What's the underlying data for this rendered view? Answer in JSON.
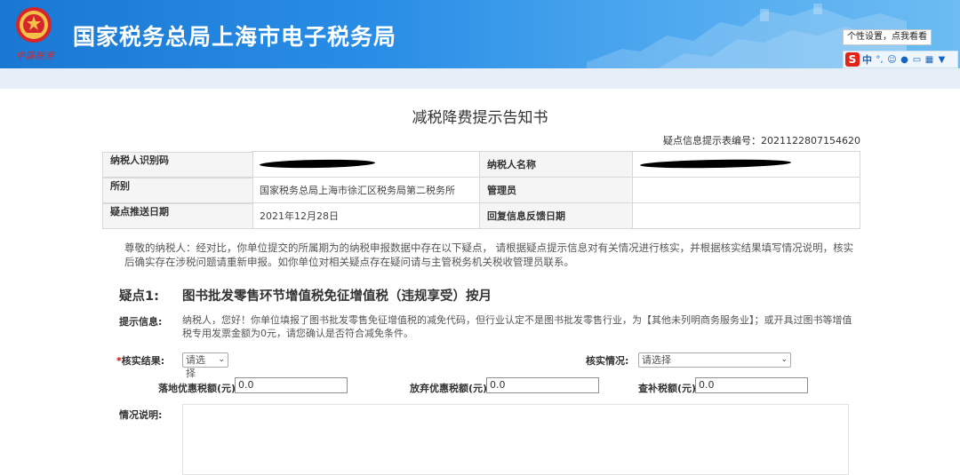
{
  "header": {
    "site_title": "国家税务总局上海市电子税务局",
    "logo_text": "中国税务",
    "tooltip": "个性设置，点我看看",
    "ime_logo": "S",
    "ime_mode": "中",
    "ime_icons": [
      "punctuation-icon",
      "emoji-icon",
      "mic-icon",
      "keyboard-icon",
      "skin-icon",
      "tshirt-icon"
    ]
  },
  "doc": {
    "title": "减税降费提示告知书",
    "serial_label": "疑点信息提示表编号：",
    "serial_no": "2021122807154620"
  },
  "info_table": {
    "taxpayer_id_label": "纳税人识别码",
    "taxpayer_id_value": "",
    "taxpayer_name_label": "纳税人名称",
    "taxpayer_name_value": "",
    "office_label": "所别",
    "office_value": "国家税务总局上海市徐汇区税务局第二税务所",
    "manager_label": "管理员",
    "manager_value": "",
    "push_date_label": "疑点推送日期",
    "push_date_value": "2021年12月28日",
    "feedback_date_label": "回复信息反馈日期",
    "feedback_date_value": ""
  },
  "notice": "尊敬的纳税人：经对比，你单位提交的所属期为的纳税申报数据中存在以下疑点， 请根据疑点提示信息对有关情况进行核实，并根据核实结果填写情况说明，核实后确实存在涉税问题请重新申报。如你单位对相关疑点存在疑问请与主管税务机关税收管理员联系。",
  "issue": {
    "number_label": "疑点1:",
    "title": "图书批发零售环节增值税免征增值税（违规享受）按月",
    "hint_label": "提示信息:",
    "hint_text": "纳税人，您好！你单位填报了图书批发零售免征增值税的减免代码，但行业认定不是图书批发零售行业，为【其他未列明商务服务业】；或开具过图书等增值税专用发票金额为0元，请您确认是否符合减免条件。",
    "result_required": "*",
    "result_label": "核实结果:",
    "result_select": "请选择",
    "situation_label": "核实情况:",
    "situation_select": "请选择",
    "landing_tax_label": "落地优惠税额(元)",
    "landing_tax_value": "0.0",
    "waive_tax_label": "放弃优惠税额(元)",
    "waive_tax_value": "0.0",
    "back_tax_label": "查补税额(元)",
    "back_tax_value": "0.0",
    "explanation_label": "情况说明:"
  }
}
